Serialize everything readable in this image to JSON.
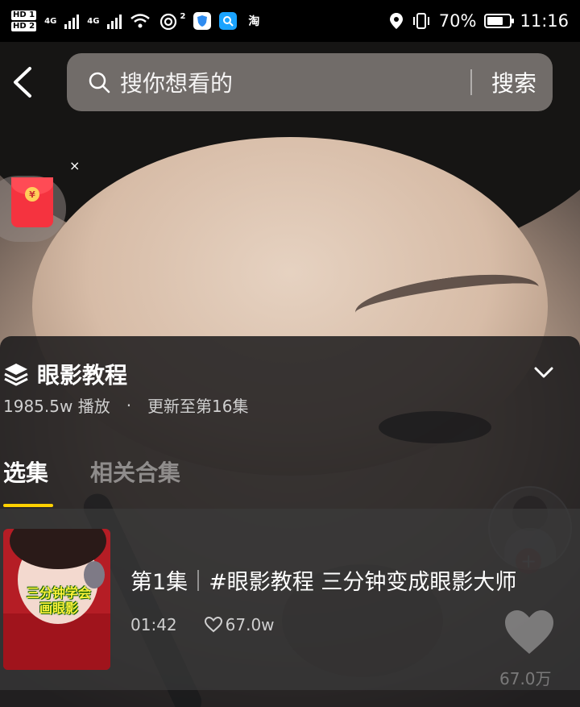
{
  "status_bar": {
    "hd1": "HD 1",
    "hd2": "HD 2",
    "net1": "4G",
    "net2": "4G",
    "wifi_badge": "2",
    "taobao_label": "淘",
    "battery_percent": "70%",
    "battery_level": 0.7,
    "time": "11:16"
  },
  "search": {
    "placeholder": "搜你想看的",
    "button_label": "搜索"
  },
  "red_packet": {
    "close_label": "×",
    "coin_label": "¥"
  },
  "collection": {
    "title": "眼影教程",
    "plays": "1985.5w 播放",
    "separator": "·",
    "update": "更新至第16集",
    "tabs": [
      {
        "label": "选集",
        "active": true
      },
      {
        "label": "相关合集",
        "active": false
      }
    ]
  },
  "episode": {
    "number": "第1集",
    "title": "#眼影教程 三分钟变成眼影大师",
    "duration": "01:42",
    "likes": "67.0w",
    "thumb_caption_line1": "三分钟学会",
    "thumb_caption_line2": "画眼影"
  },
  "side": {
    "follow_label": "+",
    "like_count": "67.0万"
  },
  "icons": [
    "back-arrow-icon",
    "search-icon",
    "stack-icon",
    "chevron-down-icon",
    "heart-icon",
    "location-icon",
    "vibrate-icon",
    "battery-icon",
    "wifi-icon",
    "signal-icon"
  ],
  "colors": {
    "accent": "#ffd100",
    "red_packet": "#f5333f"
  }
}
